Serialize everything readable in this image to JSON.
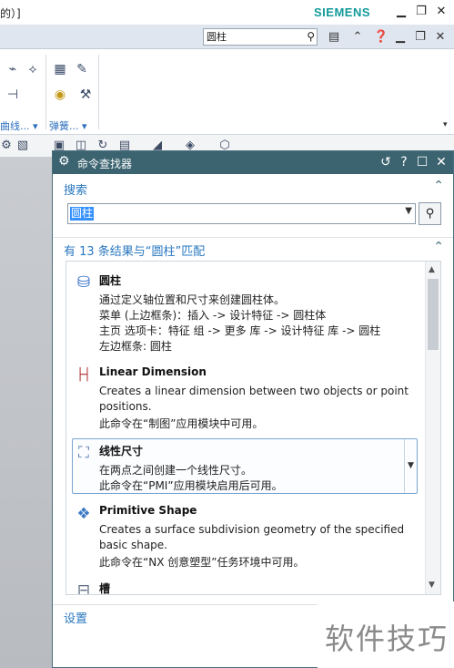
{
  "window": {
    "title_fragment": "的）]",
    "brand": "SIEMENS"
  },
  "top_search": {
    "value": "圆柱"
  },
  "ribbon": {
    "groups": [
      {
        "label": "曲线..."
      },
      {
        "label": "弹簧..."
      }
    ]
  },
  "dialog": {
    "title": "命令查找器",
    "search_section": "搜索",
    "search_value": "圆柱",
    "results_header": "有 13 条结果与“圆柱”匹配",
    "settings_section": "设置",
    "results": [
      {
        "title": "圆柱",
        "icon": "cylinder-icon",
        "lines": [
          "通过定义轴位置和尺寸来创建圆柱体。",
          "菜单 (上边框条)：插入 -> 设计特征 -> 圆柱体",
          "主页 选项卡：特征 组 -> 更多 库 -> 设计特征 库 -> 圆柱",
          "左边框条: 圆柱"
        ]
      },
      {
        "title": "Linear Dimension",
        "icon": "linear-dimension-icon",
        "lines": [
          "Creates a linear dimension between two objects or point",
          "positions.",
          "此命令在“制图”应用模块中可用。"
        ]
      },
      {
        "title": "线性尺寸",
        "icon": "pmi-linear-dimension-icon",
        "lines": [
          "在两点之间创建一个线性尺寸。",
          "此命令在“PMI”应用模块启用后可用。"
        ]
      },
      {
        "title": "Primitive Shape",
        "icon": "primitive-shape-icon",
        "lines": [
          "Creates a surface subdivision geometry of the specified",
          "basic shape.",
          "此命令在“NX 创意塑型”任务环境中可用。"
        ]
      },
      {
        "title": "槽",
        "icon": "groove-icon",
        "lines": []
      }
    ]
  },
  "watermark": {
    "text": "软件技巧"
  },
  "colors": {
    "dialog_title_bg": "#3b6470",
    "section_label": "#2a78c0",
    "brand": "#139a9a",
    "selection": "#3390ff"
  }
}
